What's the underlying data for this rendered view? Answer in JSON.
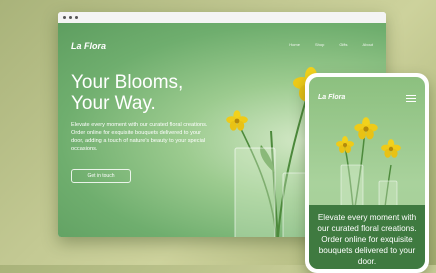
{
  "desktop": {
    "brand": "La Flora",
    "nav": [
      "Home",
      "Shop",
      "Gifts",
      "About"
    ],
    "hero_title_line1": "Your Blooms,",
    "hero_title_line2": "Your Way.",
    "hero_text": "Elevate every moment with our curated floral creations. Order online for exquisite bouquets delivered to your door, adding a touch of nature's beauty to your special occasions.",
    "cta_label": "Get in touch"
  },
  "mobile": {
    "brand": "La Flora",
    "menu_icon": "hamburger-menu-icon",
    "hero_text": "Elevate every moment with our curated floral creations. Order online for exquisite bouquets delivered to your door."
  },
  "colors": {
    "background": "#bcc387",
    "hero_green": "#6fae6e",
    "mobile_text_panel": "#3f7a40",
    "flower_yellow": "#f2d21c"
  }
}
